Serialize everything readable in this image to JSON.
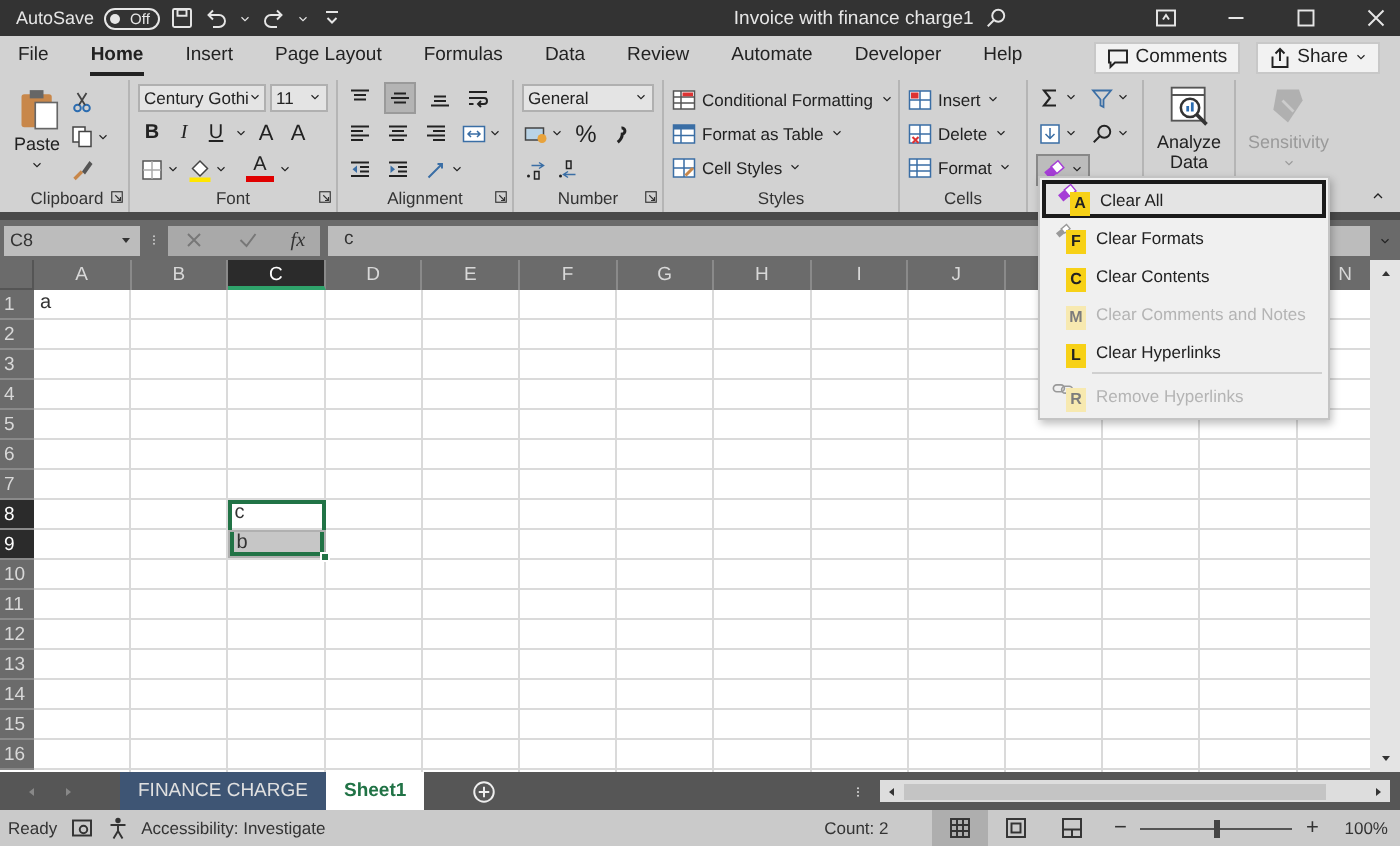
{
  "title_bar": {
    "autosave": {
      "label": "AutoSave",
      "state": "Off",
      "on": false
    },
    "title": "Invoice with finance charge1"
  },
  "tabs": [
    {
      "label": "File",
      "selected": false
    },
    {
      "label": "Home",
      "selected": true
    },
    {
      "label": "Insert",
      "selected": false
    },
    {
      "label": "Page Layout",
      "selected": false
    },
    {
      "label": "Formulas",
      "selected": false
    },
    {
      "label": "Data",
      "selected": false
    },
    {
      "label": "Review",
      "selected": false
    },
    {
      "label": "Automate",
      "selected": false
    },
    {
      "label": "Developer",
      "selected": false
    },
    {
      "label": "Help",
      "selected": false
    }
  ],
  "actions": [
    {
      "kind": "comments",
      "label": "Comments"
    },
    {
      "kind": "share",
      "label": "Share"
    }
  ],
  "ribbon": {
    "clipboard": {
      "paste": "Paste",
      "label": "Clipboard"
    },
    "font": {
      "name": "Century Gothi",
      "size": "11",
      "bold": "B",
      "italic": "I",
      "underline": "U",
      "grow": "A",
      "shrink": "A",
      "color_letter": "A",
      "label": "Font"
    },
    "alignment": {
      "rows": [
        [
          {
            "kind": "top",
            "pressed": false
          },
          {
            "kind": "middle",
            "pressed": true
          },
          {
            "kind": "bottom",
            "pressed": false
          },
          {
            "kind": "wrap",
            "pressed": false
          }
        ],
        [
          {
            "kind": "left",
            "pressed": false
          },
          {
            "kind": "center",
            "pressed": false
          },
          {
            "kind": "right",
            "pressed": false
          },
          {
            "kind": "merge",
            "pressed": false
          }
        ],
        [
          {
            "kind": "outdent",
            "pressed": false
          },
          {
            "kind": "indent",
            "pressed": false
          },
          {
            "kind": "orientation",
            "pressed": false
          }
        ]
      ],
      "label": "Alignment"
    },
    "number": {
      "format": "General",
      "percent": "%",
      "label": "Number"
    },
    "styles": {
      "items": [
        {
          "kind": "conditional",
          "label": "Conditional Formatting"
        },
        {
          "kind": "table",
          "label": "Format as Table"
        },
        {
          "kind": "cell-styles",
          "label": "Cell Styles"
        }
      ],
      "label": "Styles"
    },
    "cells": {
      "items": [
        {
          "kind": "insert",
          "label": "Insert"
        },
        {
          "kind": "delete",
          "label": "Delete"
        },
        {
          "kind": "format",
          "label": "Format"
        }
      ],
      "label": "Cells"
    },
    "editing": {
      "clear_pressed": true
    },
    "analysis": {
      "label": "Analyze Data"
    },
    "sensitivity": {
      "label": "Sensitivity",
      "disabled": true
    }
  },
  "formula_bar": {
    "name_box": "C8",
    "function_label": "fx",
    "formula": "c"
  },
  "clear_menu": {
    "items": [
      {
        "kind": "eraser",
        "label": "Clear All",
        "key": "A",
        "selected": true,
        "disabled": false
      },
      {
        "kind": "formats",
        "label": "Clear Formats",
        "key": "F",
        "selected": false,
        "disabled": false
      },
      {
        "kind": "plain",
        "label": "Clear Contents",
        "key": "C",
        "selected": false,
        "disabled": false
      },
      {
        "kind": "plain",
        "label": "Clear Comments and Notes",
        "key": "M",
        "selected": false,
        "disabled": true
      },
      {
        "kind": "plain",
        "label": "Clear Hyperlinks",
        "key": "L",
        "selected": false,
        "disabled": false
      },
      {
        "kind": "link",
        "label": "Remove Hyperlinks",
        "key": "R",
        "selected": false,
        "disabled": true
      }
    ]
  },
  "sheet": {
    "columns": [
      {
        "label": "A",
        "selected": false
      },
      {
        "label": "B",
        "selected": false
      },
      {
        "label": "C",
        "selected": true
      },
      {
        "label": "D",
        "selected": false
      },
      {
        "label": "E",
        "selected": false
      },
      {
        "label": "F",
        "selected": false
      },
      {
        "label": "G",
        "selected": false
      },
      {
        "label": "H",
        "selected": false
      },
      {
        "label": "I",
        "selected": false
      },
      {
        "label": "J",
        "selected": false
      },
      {
        "selected": false
      },
      {},
      {},
      {
        "label": "N",
        "selected": false
      }
    ],
    "rows": [
      {
        "label": "1",
        "selected": false,
        "cells": [
          {
            "value": "a",
            "selected": false
          }
        ]
      },
      {
        "label": "2",
        "selected": false
      },
      {
        "label": "3",
        "selected": false
      },
      {
        "label": "4",
        "selected": false
      },
      {
        "label": "5",
        "selected": false
      },
      {
        "label": "6",
        "selected": false
      },
      {
        "label": "7",
        "selected": false
      },
      {
        "label": "8",
        "selected": true,
        "cells": [
          null,
          null,
          {
            "value": "c",
            "selected": true,
            "active": true
          }
        ]
      },
      {
        "label": "9",
        "selected": true,
        "cells": [
          null,
          null,
          {
            "value": "b",
            "selected": true,
            "active": false
          }
        ]
      },
      {
        "label": "10",
        "selected": false
      },
      {
        "label": "11",
        "selected": false
      },
      {
        "label": "12",
        "selected": false
      },
      {
        "label": "13",
        "selected": false
      },
      {
        "label": "14",
        "selected": false
      },
      {
        "label": "15",
        "selected": false
      },
      {
        "label": "16",
        "selected": false
      }
    ]
  },
  "sheet_tabs": [
    {
      "label": "FINANCE CHARGE",
      "selected": false,
      "color": "#3e5574"
    },
    {
      "label": "Sheet1",
      "selected": true
    }
  ],
  "status_bar": {
    "mode": "Ready",
    "accessibility": "Accessibility: Investigate",
    "count": "Count: 2",
    "views": [
      {
        "kind": "normal",
        "selected": true
      },
      {
        "kind": "page-layout",
        "selected": false
      },
      {
        "kind": "page-break",
        "selected": false
      }
    ],
    "zoom": {
      "minus": "−",
      "plus": "+",
      "level": 0.5,
      "reading": "100%"
    }
  }
}
